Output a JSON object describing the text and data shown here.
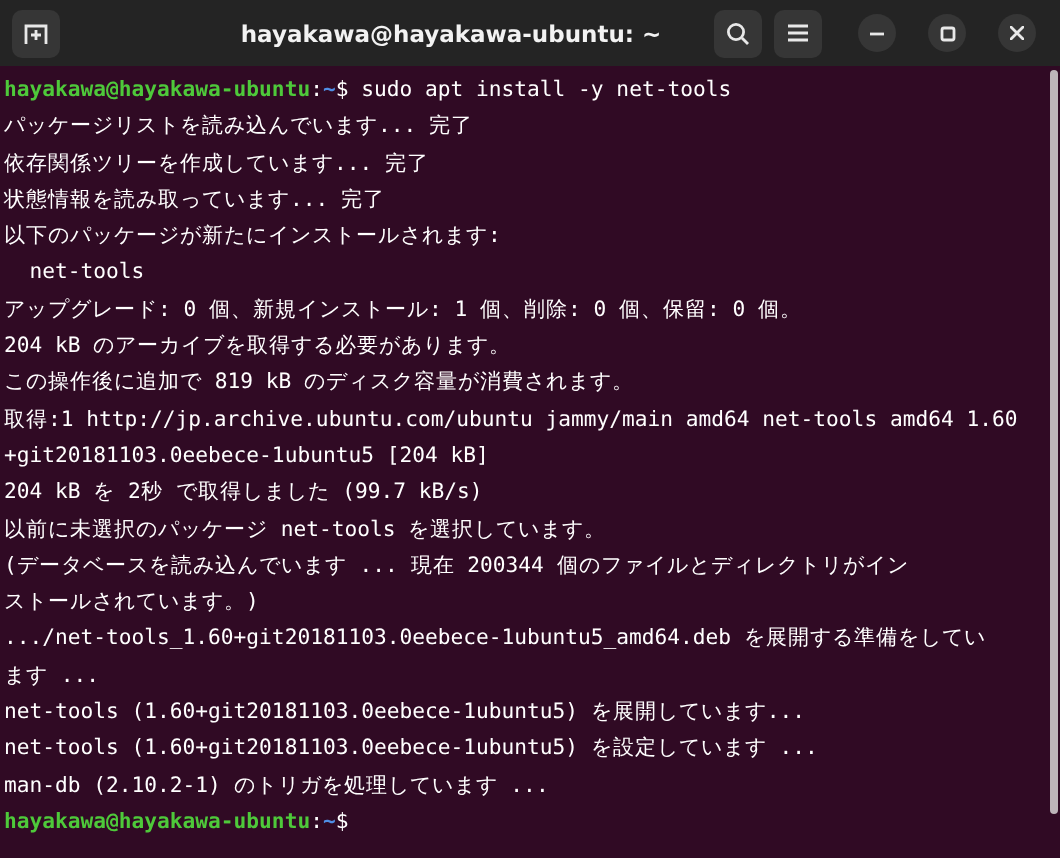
{
  "window": {
    "title": "hayakawa@hayakawa-ubuntu: ~"
  },
  "terminal": {
    "lines": [
      {
        "kind": "prompt",
        "user": "hayakawa@hayakawa-ubuntu",
        "separator": ":",
        "path": "~",
        "symbol": "$",
        "command": "sudo apt install -y net-tools"
      },
      {
        "kind": "output",
        "text": "パッケージリストを読み込んでいます... 完了"
      },
      {
        "kind": "output",
        "text": "依存関係ツリーを作成しています... 完了"
      },
      {
        "kind": "output",
        "text": "状態情報を読み取っています... 完了"
      },
      {
        "kind": "output",
        "text": "以下のパッケージが新たにインストールされます:"
      },
      {
        "kind": "output",
        "text": "  net-tools"
      },
      {
        "kind": "output",
        "text": "アップグレード: 0 個、新規インストール: 1 個、削除: 0 個、保留: 0 個。"
      },
      {
        "kind": "output",
        "text": "204 kB のアーカイブを取得する必要があります。"
      },
      {
        "kind": "output",
        "text": "この操作後に追加で 819 kB のディスク容量が消費されます。"
      },
      {
        "kind": "output",
        "text": "取得:1 http://jp.archive.ubuntu.com/ubuntu jammy/main amd64 net-tools amd64 1.60"
      },
      {
        "kind": "output",
        "text": "+git20181103.0eebece-1ubuntu5 [204 kB]"
      },
      {
        "kind": "output",
        "text": "204 kB を 2秒 で取得しました (99.7 kB/s)"
      },
      {
        "kind": "output",
        "text": "以前に未選択のパッケージ net-tools を選択しています。"
      },
      {
        "kind": "output",
        "text": "(データベースを読み込んでいます ... 現在 200344 個のファイルとディレクトリがイン"
      },
      {
        "kind": "output",
        "text": "ストールされています。)"
      },
      {
        "kind": "output",
        "text": ".../net-tools_1.60+git20181103.0eebece-1ubuntu5_amd64.deb を展開する準備をしてい"
      },
      {
        "kind": "output",
        "text": "ます ..."
      },
      {
        "kind": "output",
        "text": "net-tools (1.60+git20181103.0eebece-1ubuntu5) を展開しています..."
      },
      {
        "kind": "output",
        "text": "net-tools (1.60+git20181103.0eebece-1ubuntu5) を設定しています ..."
      },
      {
        "kind": "output",
        "text": "man-db (2.10.2-1) のトリガを処理しています ..."
      },
      {
        "kind": "prompt",
        "user": "hayakawa@hayakawa-ubuntu",
        "separator": ":",
        "path": "~",
        "symbol": "$"
      }
    ]
  }
}
